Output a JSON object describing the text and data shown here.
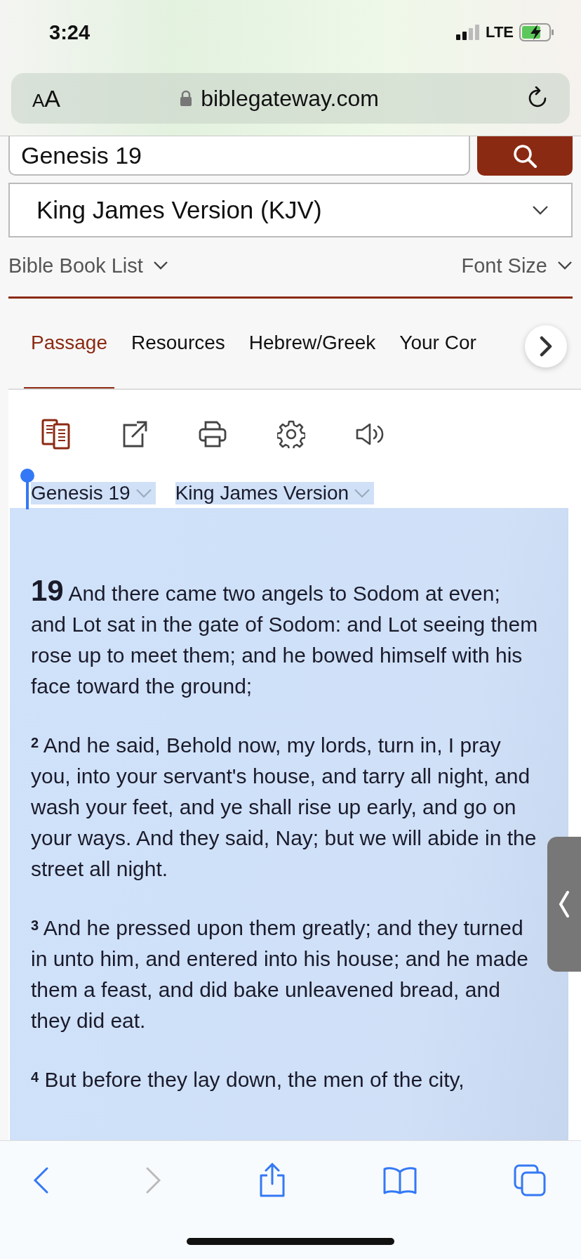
{
  "status_bar": {
    "time": "3:24",
    "network": "LTE"
  },
  "browser": {
    "text_size_button": "AA",
    "url": "biblegateway.com",
    "back_enabled": true,
    "forward_enabled": false
  },
  "search": {
    "value": "Genesis 19"
  },
  "version_select": {
    "value": "King James Version (KJV)"
  },
  "links": [
    "Bible Book List",
    "Font Size"
  ],
  "tabs": [
    {
      "label": "Passage",
      "selected": true
    },
    {
      "label": "Resources",
      "selected": false
    },
    {
      "label": "Hebrew/Greek",
      "selected": false
    },
    {
      "label": "Your Cor",
      "selected": false
    }
  ],
  "passage": {
    "reference": "Genesis 19",
    "version": "King James Version",
    "selected": true,
    "verses": [
      {
        "kind": "chapter",
        "number": "19",
        "text": "And there came two angels to Sodom at even; and Lot sat in the gate of Sodom: and Lot seeing them rose up to meet them; and he bowed himself with his face toward the ground;"
      },
      {
        "kind": "verse",
        "number": "2",
        "text": "And he said, Behold now, my lords, turn in, I pray you, into your servant's house, and tarry all night, and wash your feet, and ye shall rise up early, and go on your ways. And they said, Nay; but we will abide in the street all night."
      },
      {
        "kind": "verse",
        "number": "3",
        "text": "And he pressed upon them greatly; and they turned in unto him, and entered into his house; and he made them a feast, and did bake unleavened bread, and they did eat."
      },
      {
        "kind": "verse",
        "number": "4",
        "text": "But before they lay down, the men of the city,"
      }
    ]
  }
}
